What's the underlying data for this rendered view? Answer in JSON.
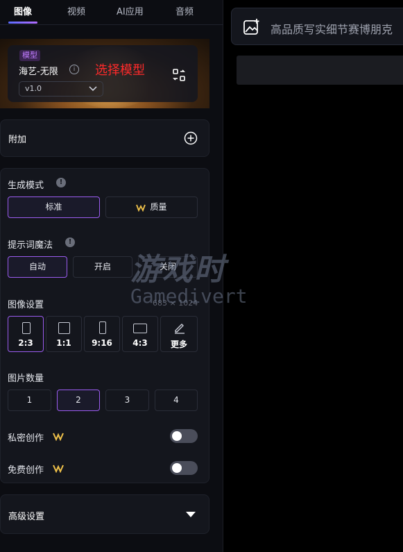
{
  "tabs": [
    "图像",
    "视频",
    "AI应用",
    "音频"
  ],
  "model": {
    "tag": "模型",
    "name": "海艺-无限",
    "info_glyph": "i",
    "choose_label": "选择模型",
    "version": "v1.0"
  },
  "addon": {
    "title": "附加"
  },
  "generation_mode": {
    "label": "生成模式",
    "options": [
      "标准",
      "质量"
    ],
    "selected": "标准"
  },
  "prompt_magic": {
    "label": "提示词魔法",
    "options": [
      "自动",
      "开启",
      "关闭"
    ],
    "selected": "自动"
  },
  "image_settings": {
    "label": "图像设置",
    "dimensions": "683 × 1024",
    "ratios": [
      "2:3",
      "1:1",
      "9:16",
      "4:3",
      "更多"
    ],
    "selected": "2:3"
  },
  "image_count": {
    "label": "图片数量",
    "options": [
      "1",
      "2",
      "3",
      "4"
    ],
    "selected": "2"
  },
  "private_create": {
    "label": "私密创作",
    "enabled": false
  },
  "free_create": {
    "label": "免费创作",
    "enabled": false
  },
  "advanced": {
    "label": "高级设置"
  },
  "help_glyph": "!",
  "prompt": {
    "text": "高品质写实细节赛博朋克"
  },
  "watermark": {
    "cn": "游戏时",
    "en": "Gamedivert"
  },
  "colors": {
    "accent": "#9b5cf0",
    "highlight_red": "#ff2a2a",
    "panel": "#14161d"
  }
}
